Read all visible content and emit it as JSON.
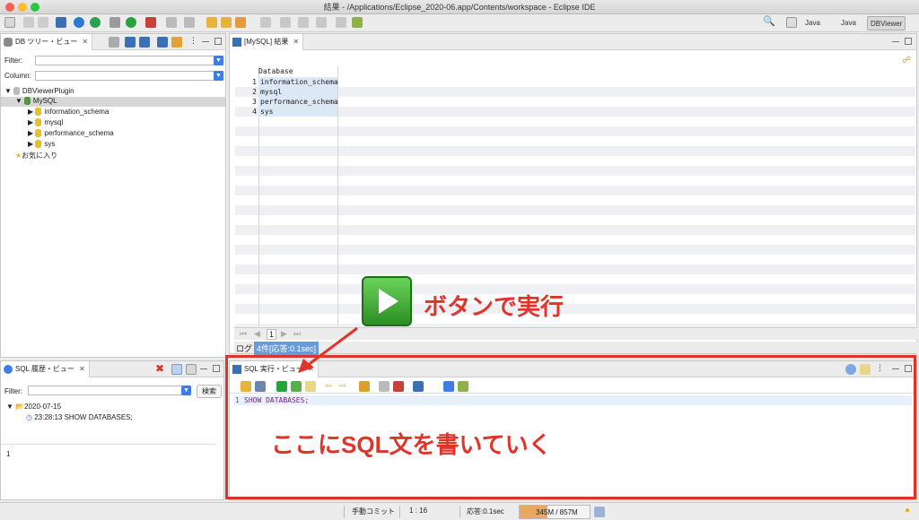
{
  "window": {
    "title": "結果 - /Applications/Eclipse_2020-06.app/Contents/workspace - Eclipse IDE",
    "perspectives": [
      "Java",
      "Java",
      "DBViewer"
    ]
  },
  "db_tree_view": {
    "tab_label": "DB ツリー・ビュー",
    "filter_label": "Filter:",
    "column_label": "Column:",
    "root": "DBViewerPlugin",
    "connection": "MySQL",
    "schemas": [
      "information_schema",
      "mysql",
      "performance_schema",
      "sys"
    ],
    "favorites": "お気に入り"
  },
  "result_view": {
    "tab_label": "[MySQL] 結果",
    "column_header": "Database",
    "rows": [
      {
        "num": "1",
        "value": "information_schema"
      },
      {
        "num": "2",
        "value": "mysql"
      },
      {
        "num": "3",
        "value": "performance_schema"
      },
      {
        "num": "4",
        "value": "sys"
      }
    ],
    "page_number": "1",
    "log_label": "ログ",
    "log_message": "4件[応答:0.1sec]"
  },
  "sql_history_view": {
    "tab_label": "SQL 履歴・ビュー",
    "filter_label": "Filter:",
    "search_button": "検索",
    "date": "2020-07-15",
    "entry": "23:28:13 SHOW DATABASES;",
    "line_number": "1"
  },
  "sql_exec_view": {
    "tab_label": "SQL 実行・ビュー",
    "line_number": "1",
    "code": "SHOW DATABASES;"
  },
  "annotations": {
    "run_button_caption": "ボタンで実行",
    "editor_caption": "ここにSQL文を書いていく",
    "accent_color": "#e0342a"
  },
  "status_bar": {
    "commit_mode": "手動コミット",
    "cursor_pos": "1 : 16",
    "response": "応答:0.1sec",
    "memory": "345M / 857M",
    "memory_used_fraction": 0.4
  }
}
